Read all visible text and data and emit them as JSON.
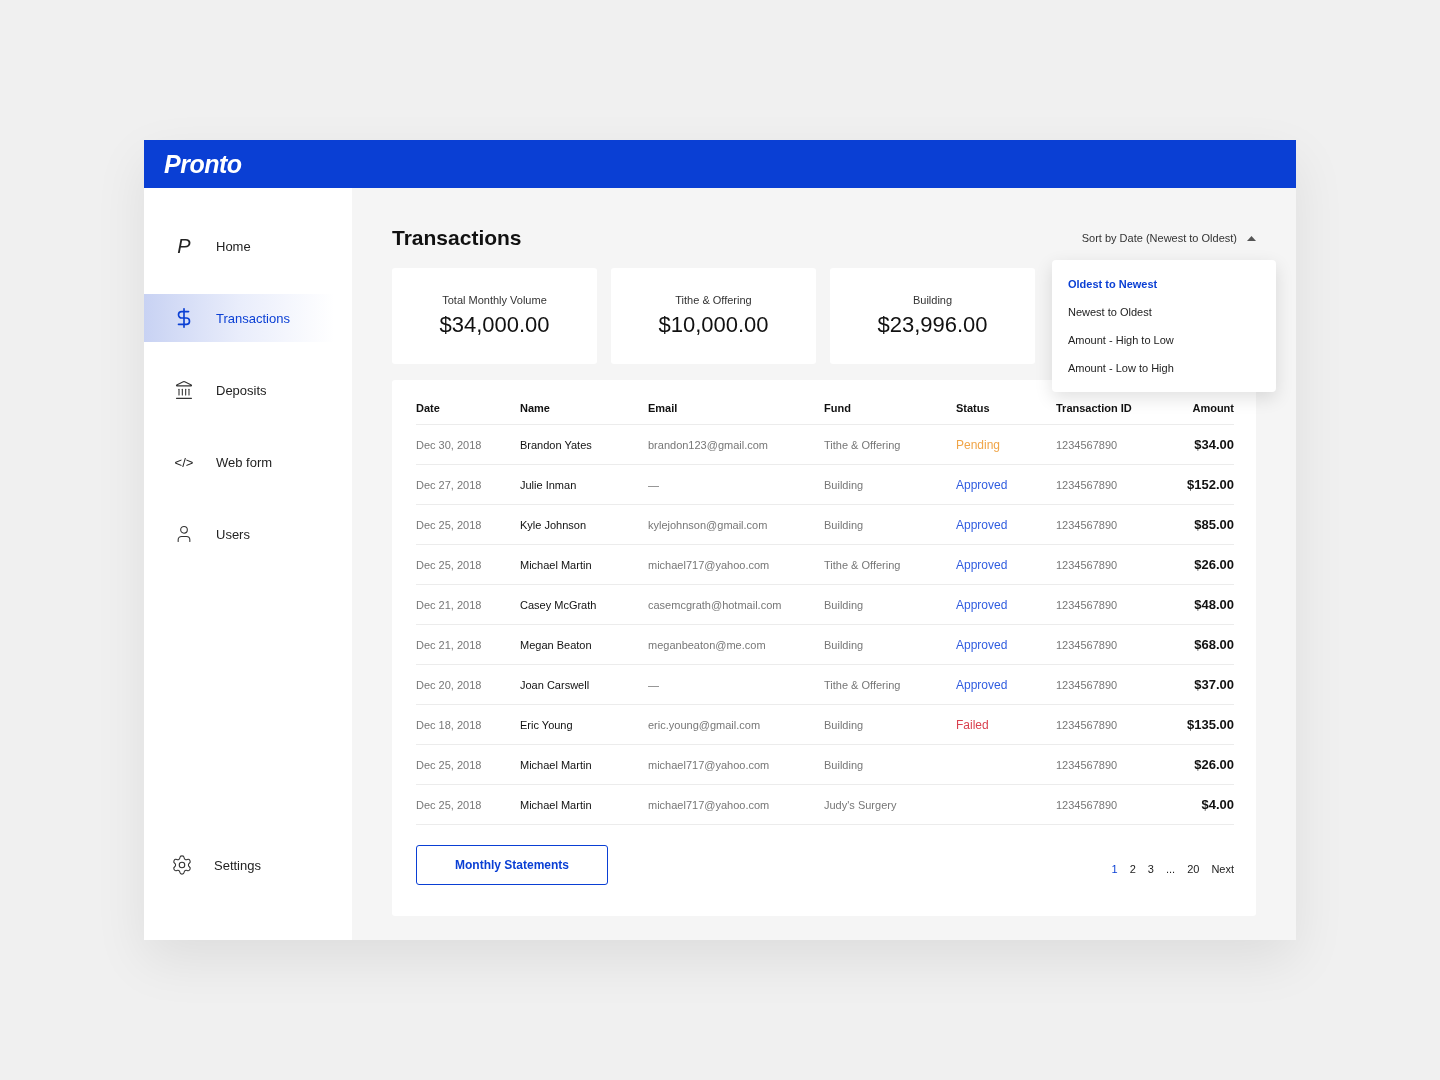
{
  "header": {
    "logo": "Pronto"
  },
  "sidebar": {
    "items": [
      {
        "label": "Home",
        "kind": "letter",
        "glyph": "P",
        "selected": false
      },
      {
        "label": "Transactions",
        "kind": "dollar",
        "selected": true
      },
      {
        "label": "Deposits",
        "kind": "bank",
        "selected": false
      },
      {
        "label": "Web form",
        "kind": "letter",
        "glyph": "</>",
        "selected": false
      },
      {
        "label": "Users",
        "kind": "user",
        "selected": false
      }
    ],
    "settings": {
      "label": "Settings",
      "kind": "gear"
    }
  },
  "page": {
    "title": "Transactions",
    "sort": {
      "label": "Sort by Date (Newest to Oldest)",
      "expanded": true,
      "options": [
        {
          "label": "Oldest to Newest",
          "selected": true
        },
        {
          "label": "Newest to Oldest",
          "selected": false
        },
        {
          "label": "Amount - High to Low",
          "selected": false
        },
        {
          "label": "Amount - Low to High",
          "selected": false
        }
      ]
    }
  },
  "stats": [
    {
      "label": "Total Monthly Volume",
      "value": "$34,000.00"
    },
    {
      "label": "Tithe & Offering",
      "value": "$10,000.00"
    },
    {
      "label": "Building",
      "value": "$23,996.00"
    }
  ],
  "table": {
    "columns": [
      "Date",
      "Name",
      "Email",
      "Fund",
      "Status",
      "Transaction ID",
      "Amount"
    ],
    "rows": [
      {
        "date": "Dec 30, 2018",
        "name": "Brandon Yates",
        "email": "brandon123@gmail.com",
        "fund": "Tithe & Offering",
        "status": "Pending",
        "kind": "pending",
        "id": "1234567890",
        "amount": "$34.00"
      },
      {
        "date": "Dec 27, 2018",
        "name": "Julie Inman",
        "email": "—",
        "fund": "Building",
        "status": "Approved",
        "kind": "approved",
        "id": "1234567890",
        "amount": "$152.00"
      },
      {
        "date": "Dec 25, 2018",
        "name": "Kyle Johnson",
        "email": "kylejohnson@gmail.com",
        "fund": "Building",
        "status": "Approved",
        "kind": "approved",
        "id": "1234567890",
        "amount": "$85.00"
      },
      {
        "date": "Dec 25, 2018",
        "name": "Michael Martin",
        "email": "michael717@yahoo.com",
        "fund": "Tithe & Offering",
        "status": "Approved",
        "kind": "approved",
        "id": "1234567890",
        "amount": "$26.00"
      },
      {
        "date": "Dec 21, 2018",
        "name": "Casey McGrath",
        "email": "casemcgrath@hotmail.com",
        "fund": "Building",
        "status": "Approved",
        "kind": "approved",
        "id": "1234567890",
        "amount": "$48.00"
      },
      {
        "date": "Dec 21, 2018",
        "name": "Megan Beaton",
        "email": "meganbeaton@me.com",
        "fund": "Building",
        "status": "Approved",
        "kind": "approved",
        "id": "1234567890",
        "amount": "$68.00"
      },
      {
        "date": "Dec 20, 2018",
        "name": "Joan Carswell",
        "email": "—",
        "fund": "Tithe & Offering",
        "status": "Approved",
        "kind": "approved",
        "id": "1234567890",
        "amount": "$37.00"
      },
      {
        "date": "Dec 18, 2018",
        "name": "Eric Young",
        "email": "eric.young@gmail.com",
        "fund": "Building",
        "status": "Failed",
        "kind": "failed",
        "id": "1234567890",
        "amount": "$135.00"
      },
      {
        "date": "Dec 25, 2018",
        "name": "Michael Martin",
        "email": "michael717@yahoo.com",
        "fund": "Building",
        "id": "1234567890",
        "amount": "$26.00"
      },
      {
        "date": "Dec 25, 2018",
        "name": "Michael Martin",
        "email": "michael717@yahoo.com",
        "fund": "Judy's Surgery",
        "id": "1234567890",
        "amount": "$4.00"
      }
    ]
  },
  "footer": {
    "button": "Monthly Statements",
    "pages": [
      {
        "label": "1",
        "selected": true
      },
      {
        "label": "2",
        "selected": false
      },
      {
        "label": "3",
        "selected": false
      },
      {
        "label": "...",
        "selected": false
      },
      {
        "label": "20",
        "selected": false
      }
    ],
    "next": "Next"
  }
}
